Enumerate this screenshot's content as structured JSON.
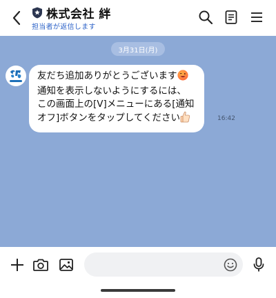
{
  "header": {
    "title": "株式会社 絆",
    "subtitle": "担当者が返信します"
  },
  "chat": {
    "date": "3月31日(月)",
    "message": {
      "lines": [
        "友だち追加ありがとうございます",
        "通知を表示しないようにするには、",
        "この画面上の[V]メニューにある[通知",
        "オフ]ボタンをタップしてください"
      ],
      "time": "16:42"
    }
  },
  "input": {
    "placeholder": ""
  },
  "icons": {
    "back": "chevron-left-icon",
    "verified": "shield-star-icon",
    "search": "search-icon",
    "notes": "notes-icon",
    "menu": "hamburger-menu-icon",
    "add": "plus-icon",
    "camera": "camera-icon",
    "image": "image-icon",
    "emoji": "smiley-icon",
    "mic": "microphone-icon"
  },
  "colors": {
    "chat_background": "#8ca9d6",
    "subtitle": "#2f64c8",
    "bubble": "#ffffff"
  }
}
